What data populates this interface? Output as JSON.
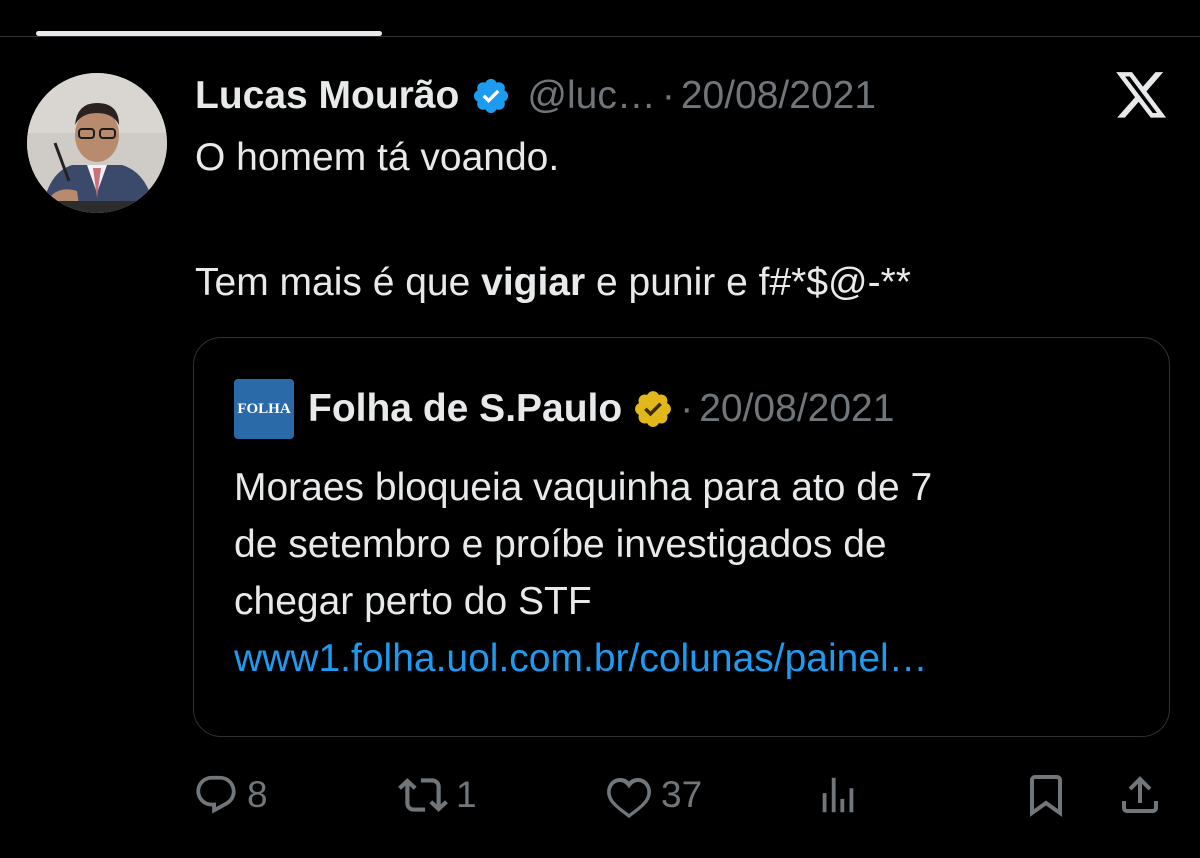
{
  "tweet": {
    "author_name": "Lucas Mourão",
    "handle": "@luc…",
    "date_separator": "·",
    "date": "20/08/2021",
    "text_line1": "O homem tá voando.",
    "text_line2_pre": "Tem mais é que ",
    "text_line2_bold": "vigiar",
    "text_line2_post": " e punir e f#*$@-**"
  },
  "quoted_tweet": {
    "logo_text": "FOLHA",
    "author_name": "Folha de S.Paulo",
    "date_separator": "·",
    "date": "20/08/2021",
    "text_lines": [
      "Moraes bloqueia vaquinha para ato de 7",
      "de setembro e proíbe investigados de",
      "chegar perto do STF"
    ],
    "link": "www1.folha.uol.com.br/colunas/painel…"
  },
  "actions": {
    "replies": "8",
    "retweets": "1",
    "likes": "37"
  },
  "icons": {
    "verified_badge": "blue-verified-badge",
    "quoted_badge": "gold-verified-badge",
    "platform": "x-logo"
  },
  "colors": {
    "background": "#000000",
    "text": "#e7e9ea",
    "muted": "#71767b",
    "link": "#1d9bf0",
    "verified_blue": "#1d9bf0",
    "verified_gold": "#e2b719",
    "folha_blue": "#2b6aa9"
  }
}
